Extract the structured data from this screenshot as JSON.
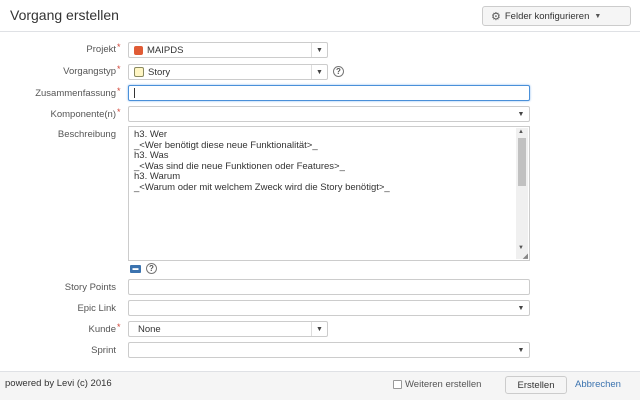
{
  "header": {
    "title": "Vorgang erstellen",
    "configure_label": "Felder konfigurieren",
    "configure_icon": "gear-icon"
  },
  "form": {
    "project": {
      "label": "Projekt",
      "value": "MAIPDS"
    },
    "issue_type": {
      "label": "Vorgangstyp",
      "value": "Story"
    },
    "summary": {
      "label": "Zusammenfassung",
      "value": ""
    },
    "components": {
      "label": "Komponente(n)",
      "value": ""
    },
    "description": {
      "label": "Beschreibung",
      "lines": [
        "h3. Wer",
        "_<Wer benötigt diese neue Funktionalität>_",
        "",
        "",
        "h3. Was",
        "_<Was sind die neue Funktionen oder Features>_",
        "",
        "",
        "h3. Warum",
        "_<Warum oder mit welchem Zweck wird die Story benötigt>_"
      ]
    },
    "story_points": {
      "label": "Story Points",
      "value": ""
    },
    "epic_link": {
      "label": "Epic Link",
      "value": ""
    },
    "customer": {
      "label": "Kunde",
      "value": "None"
    },
    "sprint": {
      "label": "Sprint",
      "value": ""
    }
  },
  "footer": {
    "powered_by": "powered by Levi (c) 2016",
    "create_another": "Weiteren erstellen",
    "submit_label": "Erstellen",
    "cancel_label": "Abbrechen"
  },
  "colors": {
    "required": "#d04437",
    "link": "#3b73af",
    "focus": "#4a90d9"
  }
}
